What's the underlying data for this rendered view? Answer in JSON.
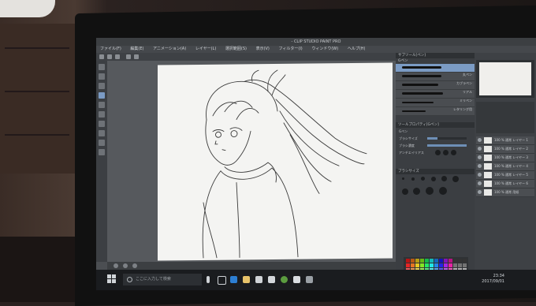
{
  "window": {
    "title": "- CLIP STUDIO PAINT PRO"
  },
  "menu": [
    "ファイル(F)",
    "編集(E)",
    "アニメーション(A)",
    "レイヤー(L)",
    "選択範囲(S)",
    "表示(V)",
    "フィルター(I)",
    "ウィンドウ(W)",
    "ヘルプ(H)"
  ],
  "brush_panel": {
    "header": "サブツール[ペン]",
    "tab": "Gペン",
    "items": [
      "丸ペン",
      "カブラペン",
      "リアル",
      "ミリペン",
      "レタリング用"
    ]
  },
  "tool_property": {
    "header": "ツールプロパティ[Gペン]",
    "brush_name": "Gペン",
    "rows": [
      {
        "label": "ブラシサイズ",
        "value": "5.0",
        "fill": 0.25
      },
      {
        "label": "ブラシ濃度",
        "value": "100",
        "fill": 1.0
      },
      {
        "label": "アンチエイリアス",
        "value": "",
        "fill": 0.5
      }
    ]
  },
  "brush_size_panel": {
    "header": "ブラシサイズ"
  },
  "layers": [
    {
      "name": "100 % 通常 レイヤー 1"
    },
    {
      "name": "100 % 通常 レイヤー 2"
    },
    {
      "name": "100 % 通常 レイヤー 3"
    },
    {
      "name": "100 % 通常 レイヤー 4"
    },
    {
      "name": "100 % 通常 レイヤー 5"
    },
    {
      "name": "100 % 通常 レイヤー 6"
    },
    {
      "name": "100 % 通常 用紙"
    }
  ],
  "taskbar": {
    "search_placeholder": "ここに入力して検索",
    "time": "23:34",
    "date": "2017/09/01"
  },
  "colors": {
    "selection_blue": "#7b9bc4",
    "panel_dark": "#3b3e42",
    "canvas_paper": "#f4f4f2"
  }
}
